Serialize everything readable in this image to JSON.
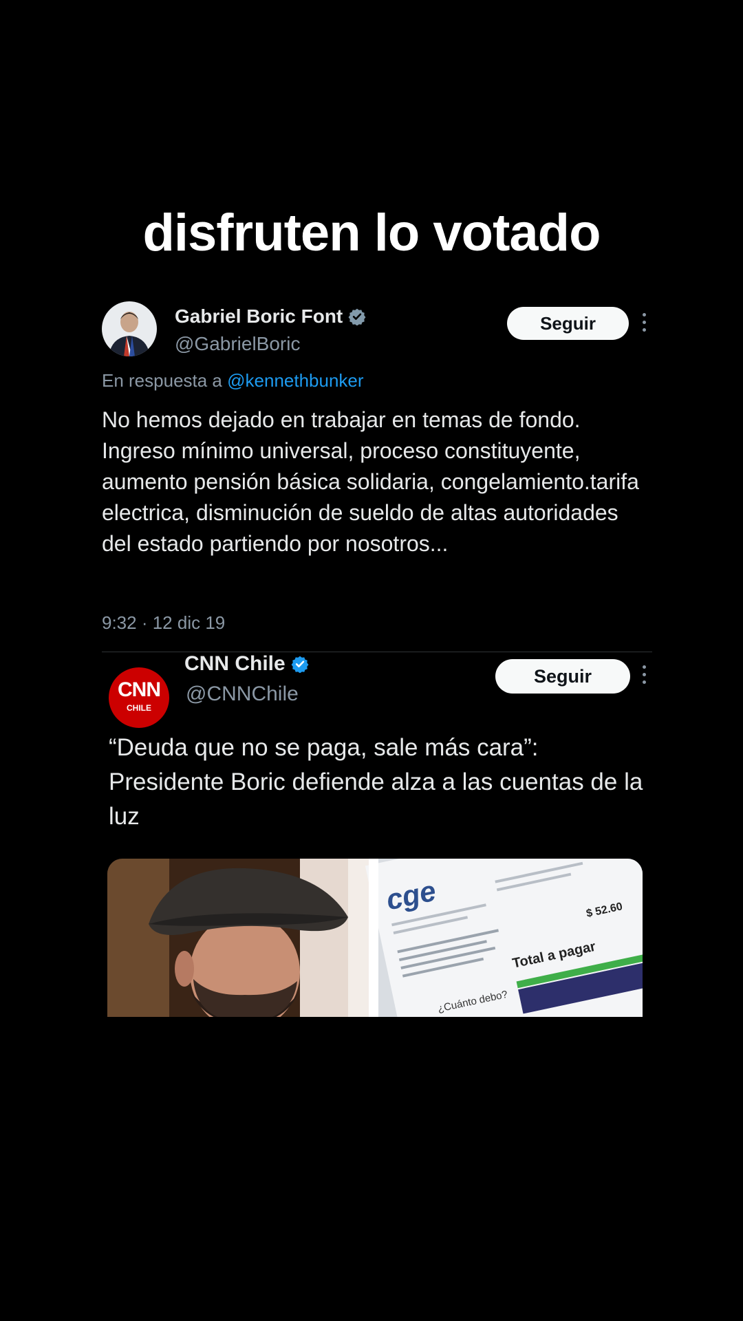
{
  "caption": "disfruten lo votado",
  "tweet1": {
    "name": "Gabriel Boric Font",
    "handle": "@GabrielBoric",
    "follow_label": "Seguir",
    "reply_prefix": "En respuesta a",
    "reply_to": "@kennethbunker",
    "text": "No hemos dejado en trabajar en temas de fondo. Ingreso mínimo universal, proceso constituyente, aumento pensión básica solidaria, congelamiento.tarifa electrica, disminución de sueldo de altas autoridades del estado partiendo por nosotros...",
    "timestamp": "9:32 · 12 dic 19",
    "icons": {
      "verified": "verified-badge-icon",
      "more": "more-options-icon"
    }
  },
  "tweet2": {
    "name": "CNN Chile",
    "handle": "@CNNChile",
    "follow_label": "Seguir",
    "avatar_text": "CNN",
    "avatar_sub": "CHILE",
    "text": "“Deuda que no se paga, sale más cara”: Presidente Boric defiende alza a las cuentas de la luz",
    "media": {
      "bill_logo": "cge",
      "bill_amount": "$ 52.60",
      "bill_total_label": "Total a pagar",
      "bill_question": "¿Cuánto debo?"
    }
  },
  "colors": {
    "background": "#000000",
    "text": "#e7e9ea",
    "secondary": "#8b98a5",
    "link": "#1d9bf0",
    "cnn_red": "#cc0000"
  }
}
